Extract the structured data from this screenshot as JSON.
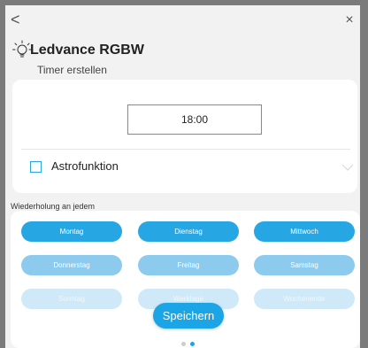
{
  "header": {
    "back_glyph": "<",
    "close_glyph": "×",
    "device_name": "Ledvance RGBW",
    "subtitle": "Timer erstellen",
    "icon": "lightbulb-icon"
  },
  "timer": {
    "time": "18:00"
  },
  "astro": {
    "label": "Astrofunktion",
    "checked": false,
    "chevron_icon": "chevron-down-icon"
  },
  "repeat": {
    "label": "Wiederholung an jedem",
    "days": [
      {
        "label": "Montag"
      },
      {
        "label": "Dienstag"
      },
      {
        "label": "Mittwoch"
      },
      {
        "label": "Donnerstag"
      },
      {
        "label": "Freitag"
      },
      {
        "label": "Samstag"
      },
      {
        "label": "Sonntag"
      },
      {
        "label": "Werktage"
      },
      {
        "label": "Wochenende"
      }
    ]
  },
  "actions": {
    "save_label": "Speichern"
  },
  "pager": {
    "count": 2,
    "active": 2
  },
  "colors": {
    "accent": "#1ba5e6",
    "checkbox": "#2aa6e0",
    "background": "#f2f2f2"
  }
}
